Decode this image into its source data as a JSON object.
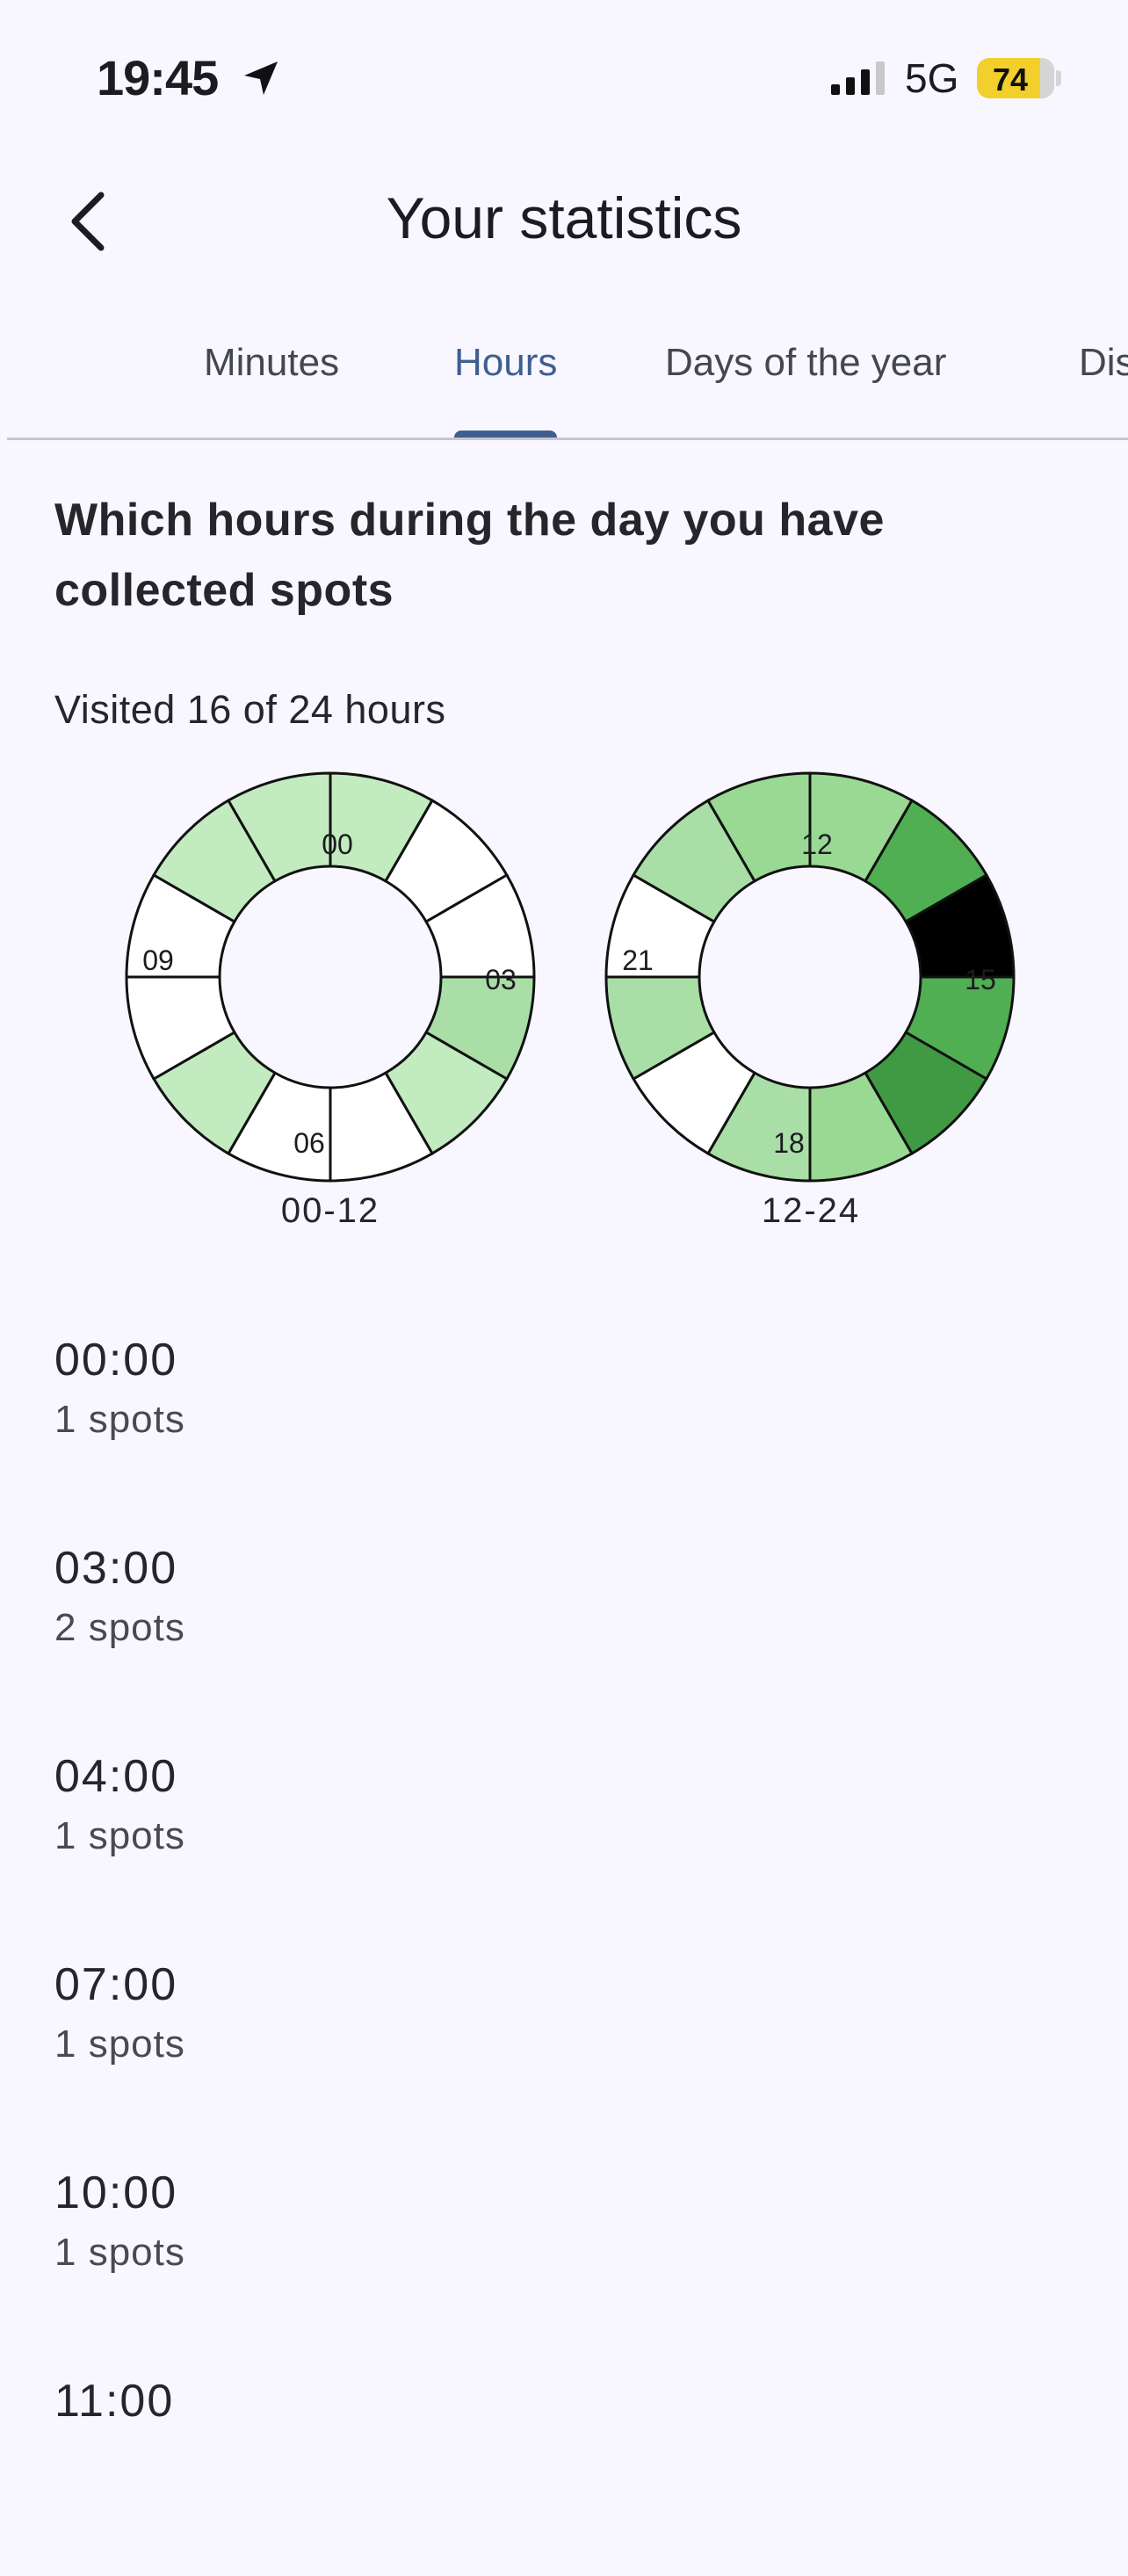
{
  "status_bar": {
    "time": "19:45",
    "network": "5G",
    "battery": "74"
  },
  "header": {
    "title": "Your statistics"
  },
  "tabs": [
    {
      "label": "Minutes",
      "active": false
    },
    {
      "label": "Hours",
      "active": true
    },
    {
      "label": "Days of the year",
      "active": false
    },
    {
      "label": "Dis",
      "active": false
    }
  ],
  "section": {
    "heading": "Which hours during the day you have collected spots",
    "visited": "Visited 16 of 24 hours"
  },
  "charts": {
    "am": {
      "caption": "00-12",
      "labels": [
        "00",
        "03",
        "06",
        "09"
      ],
      "segments": [
        {
          "hour": "00",
          "color": "#c2ebc0"
        },
        {
          "hour": "01",
          "color": "#ffffff"
        },
        {
          "hour": "02",
          "color": "#ffffff"
        },
        {
          "hour": "03",
          "color": "#a9dea6"
        },
        {
          "hour": "04",
          "color": "#c2ebc0"
        },
        {
          "hour": "05",
          "color": "#ffffff"
        },
        {
          "hour": "06",
          "color": "#ffffff"
        },
        {
          "hour": "07",
          "color": "#c2ebc0"
        },
        {
          "hour": "08",
          "color": "#ffffff"
        },
        {
          "hour": "09",
          "color": "#ffffff"
        },
        {
          "hour": "10",
          "color": "#c2ebc0"
        },
        {
          "hour": "11",
          "color": "#c2ebc0"
        }
      ]
    },
    "pm": {
      "caption": "12-24",
      "labels": [
        "12",
        "15",
        "18",
        "21"
      ],
      "segments": [
        {
          "hour": "12",
          "color": "#99d994"
        },
        {
          "hour": "13",
          "color": "#50ae53"
        },
        {
          "hour": "14",
          "color": "#000000"
        },
        {
          "hour": "15",
          "color": "#50ae53"
        },
        {
          "hour": "16",
          "color": "#3f9a43"
        },
        {
          "hour": "17",
          "color": "#99d994"
        },
        {
          "hour": "18",
          "color": "#a9dea6"
        },
        {
          "hour": "19",
          "color": "#ffffff"
        },
        {
          "hour": "20",
          "color": "#a9dea6"
        },
        {
          "hour": "21",
          "color": "#ffffff"
        },
        {
          "hour": "22",
          "color": "#a9dea6"
        },
        {
          "hour": "23",
          "color": "#99d994"
        }
      ]
    }
  },
  "hour_list": [
    {
      "time": "00:00",
      "count": "1 spots"
    },
    {
      "time": "03:00",
      "count": "2 spots"
    },
    {
      "time": "04:00",
      "count": "1 spots"
    },
    {
      "time": "07:00",
      "count": "1 spots"
    },
    {
      "time": "10:00",
      "count": "1 spots"
    },
    {
      "time": "11:00",
      "count": ""
    }
  ]
}
